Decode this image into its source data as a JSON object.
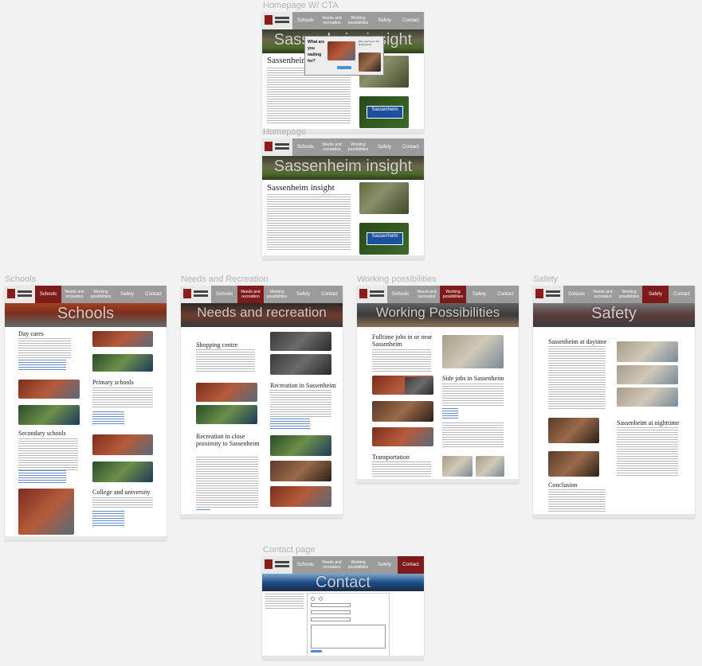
{
  "artboards": {
    "cta": {
      "label": "Homepage W/ CTA",
      "title": "Sassenheim insight",
      "heading": "Sassenheim"
    },
    "home": {
      "label": "Homepage",
      "title": "Sassenheim insight",
      "heading": "Sassenheim insight"
    },
    "schools": {
      "label": "Schools",
      "title": "Schools"
    },
    "needs": {
      "label": "Needs and Recreation",
      "title": "Needs and recreation"
    },
    "work": {
      "label": "Working possibilities",
      "title": "Working Possibilities"
    },
    "safety": {
      "label": "Safety",
      "title": "Safety"
    },
    "contact": {
      "label": "Contact page",
      "title": "Contact"
    }
  },
  "nav": {
    "schools": "Schools",
    "needs": "Needs and recreation",
    "work": "Working possibilities",
    "safety": "Safety",
    "contact": "Contact"
  },
  "popup": {
    "question": "What are you waiting for?",
    "side_text": "Plan your trip to the Netherlands"
  },
  "headings": {
    "day_cares": "Day cares",
    "primary_schools": "Primary schools",
    "secondary_schools": "Secondary schools",
    "college": "College and university",
    "shopping": "Shopping centre",
    "recreation": "Recreation in Sassenheim",
    "recreation_close": "Recreation in close proximity to Sassenheim",
    "fulltime": "Fulltime jobs in or near Sassenheim",
    "side_jobs": "Side jobs in Sassenheim",
    "transportation": "Transportation",
    "daytime": "Sassenheim at daytime",
    "nighttime": "Sassenheim at nighttime",
    "conclusion": "Conclusion"
  },
  "sign_text": "Sassenheim"
}
